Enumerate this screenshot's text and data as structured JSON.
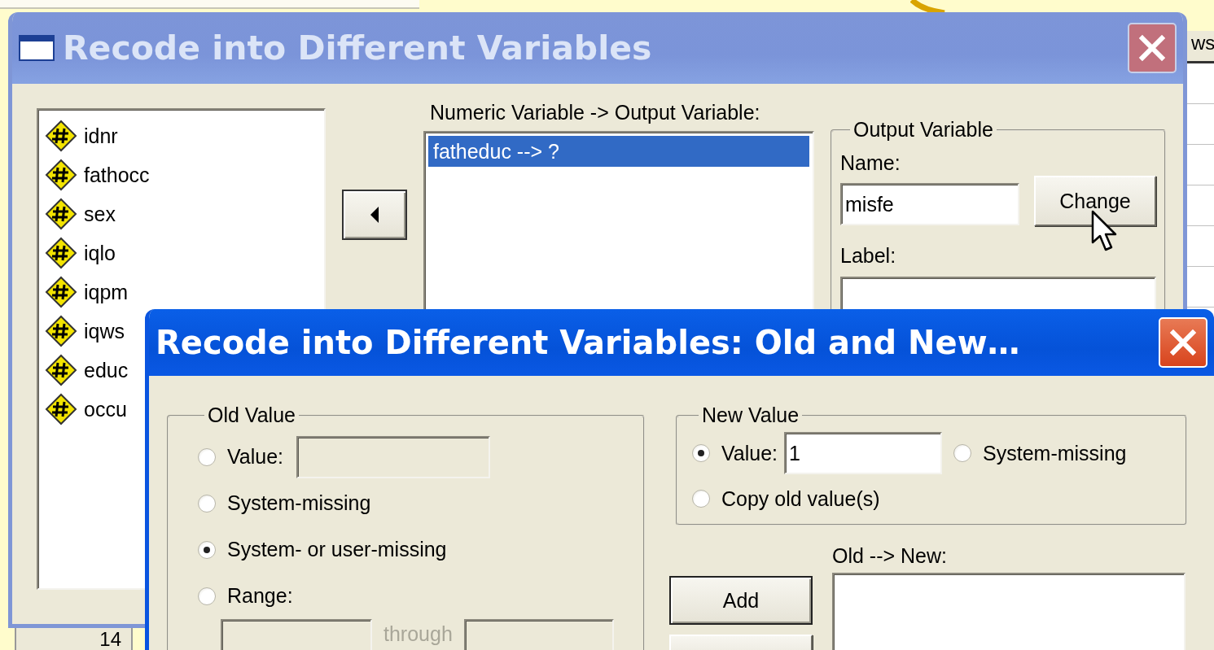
{
  "background": {
    "header_cell": "ws",
    "row_number": "14"
  },
  "main_dialog": {
    "title": "Recode into Different Variables",
    "active": false,
    "variables": [
      {
        "name": "idnr"
      },
      {
        "name": "fathocc"
      },
      {
        "name": "sex"
      },
      {
        "name": "iqlo"
      },
      {
        "name": "iqpm"
      },
      {
        "name": "iqws"
      },
      {
        "name": "educ"
      },
      {
        "name": "occu"
      }
    ],
    "mapping_label": "Numeric Variable -> Output Variable:",
    "mappings": [
      {
        "text": "fatheduc --> ?",
        "selected": true
      }
    ],
    "output_variable": {
      "title": "Output Variable",
      "name_label": "Name:",
      "name_value": "misfe",
      "change_button": "Change",
      "label_label": "Label:"
    }
  },
  "old_new_dialog": {
    "title": "Recode into Different Variables: Old and New…",
    "active": true,
    "old_value": {
      "title": "Old Value",
      "options": [
        {
          "kind": "value",
          "label": "Value:",
          "selected": false
        },
        {
          "kind": "plain",
          "label": "System-missing",
          "selected": false
        },
        {
          "kind": "plain",
          "label": "System- or user-missing",
          "selected": true
        },
        {
          "kind": "range",
          "label": "Range:",
          "selected": false
        }
      ],
      "through": "through"
    },
    "new_value": {
      "title": "New Value",
      "options": [
        {
          "kind": "value",
          "label": "Value:",
          "value": "1",
          "selected": true
        },
        {
          "kind": "plain",
          "label": "System-missing",
          "selected": false
        },
        {
          "kind": "plain",
          "label": "Copy old value(s)",
          "selected": false
        }
      ]
    },
    "old_new_label": "Old --> New:",
    "add_button": "Add"
  }
}
